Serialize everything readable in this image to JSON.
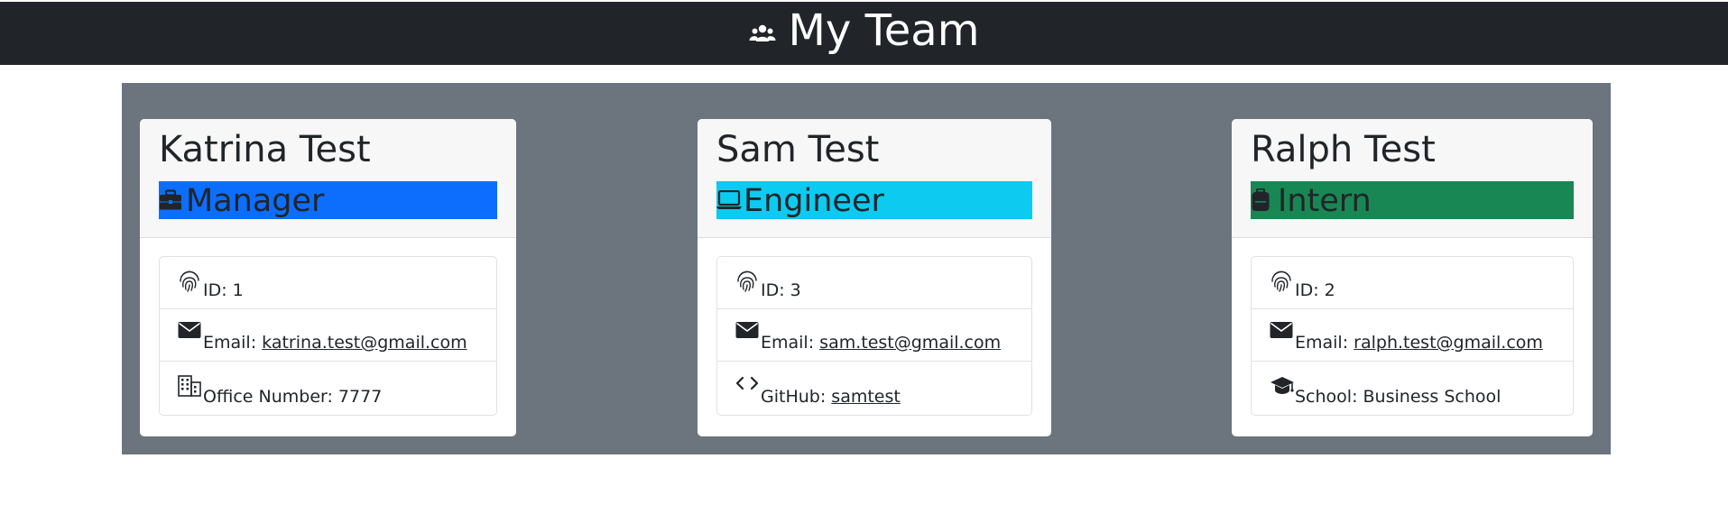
{
  "header": {
    "title": "My Team",
    "icon": "users-icon"
  },
  "colors": {
    "topbar": "#212529",
    "panel": "#6c757d",
    "manager": "#0d6efd",
    "engineer": "#0dcaf0",
    "intern": "#198754"
  },
  "cards": [
    {
      "name": "Katrina Test",
      "role": "Manager",
      "role_icon": "briefcase-icon",
      "id_label": "ID: 1",
      "email_label": "Email: ",
      "email": "katrina.test@gmail.com",
      "extra_label": "Office Number: 7777",
      "extra_icon": "building-icon"
    },
    {
      "name": "Sam Test",
      "role": "Engineer",
      "role_icon": "laptop-icon",
      "id_label": "ID: 3",
      "email_label": "Email: ",
      "email": "sam.test@gmail.com",
      "extra_label": "GitHub: ",
      "extra_link": "samtest",
      "extra_icon": "code-icon"
    },
    {
      "name": "Ralph Test",
      "role": "Intern",
      "role_icon": "backpack-icon",
      "id_label": "ID: 2",
      "email_label": "Email: ",
      "email": "ralph.test@gmail.com",
      "extra_label": "School: Business School",
      "extra_icon": "graduation-cap-icon"
    }
  ]
}
